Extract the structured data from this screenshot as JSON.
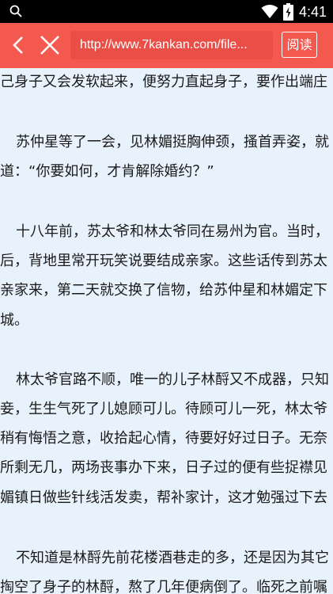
{
  "status_bar": {
    "time": "4:41",
    "icons": [
      "search-icon",
      "wifi-icon",
      "battery-icon"
    ]
  },
  "toolbar": {
    "url": "http://www.7kankan.com/file...",
    "reader_button": "阅读",
    "icons": [
      "back-arrow-icon",
      "close-icon"
    ]
  },
  "article": {
    "lines": [
      "己身子又会发软起来，便努力直起身子，要作出端庄",
      "苏仲星等了一会，见林媚挺胸伸颈，搔首弄姿，就",
      "道：“你要如何，才肯解除婚约？”",
      "十八年前，苏太爷和林太爷同在易州为官。当时，",
      "后，背地里常开玩笑说要结成亲家。这些话传到苏太",
      "亲家来，第二天就交换了信物，给苏仲星和林媚定下",
      "城。",
      "林太爷官路不顺，唯一的儿子林酹又不成器，只知",
      "妾，生生气死了儿媳顾可儿。待顾可儿一死，林太爷",
      "稍有悔悟之意，收拾起心情，待要好好过日子。无奈",
      "所剩无几，两场丧事办下来，日子过的便有些捉襟见",
      "媚镇日做些针线活发卖，帮补家计，这才勉强过下去",
      "不知道是林酹先前花楼酒巷走的多，还是因为其它",
      "掏空了身子的林酹，熬了几年便病倒了。临死之前嘱"
    ]
  },
  "colors": {
    "toolbar": "#f4594f",
    "url_field": "#e94f47",
    "page_bg": "#e8f2fc",
    "status_bar": "#000000"
  }
}
